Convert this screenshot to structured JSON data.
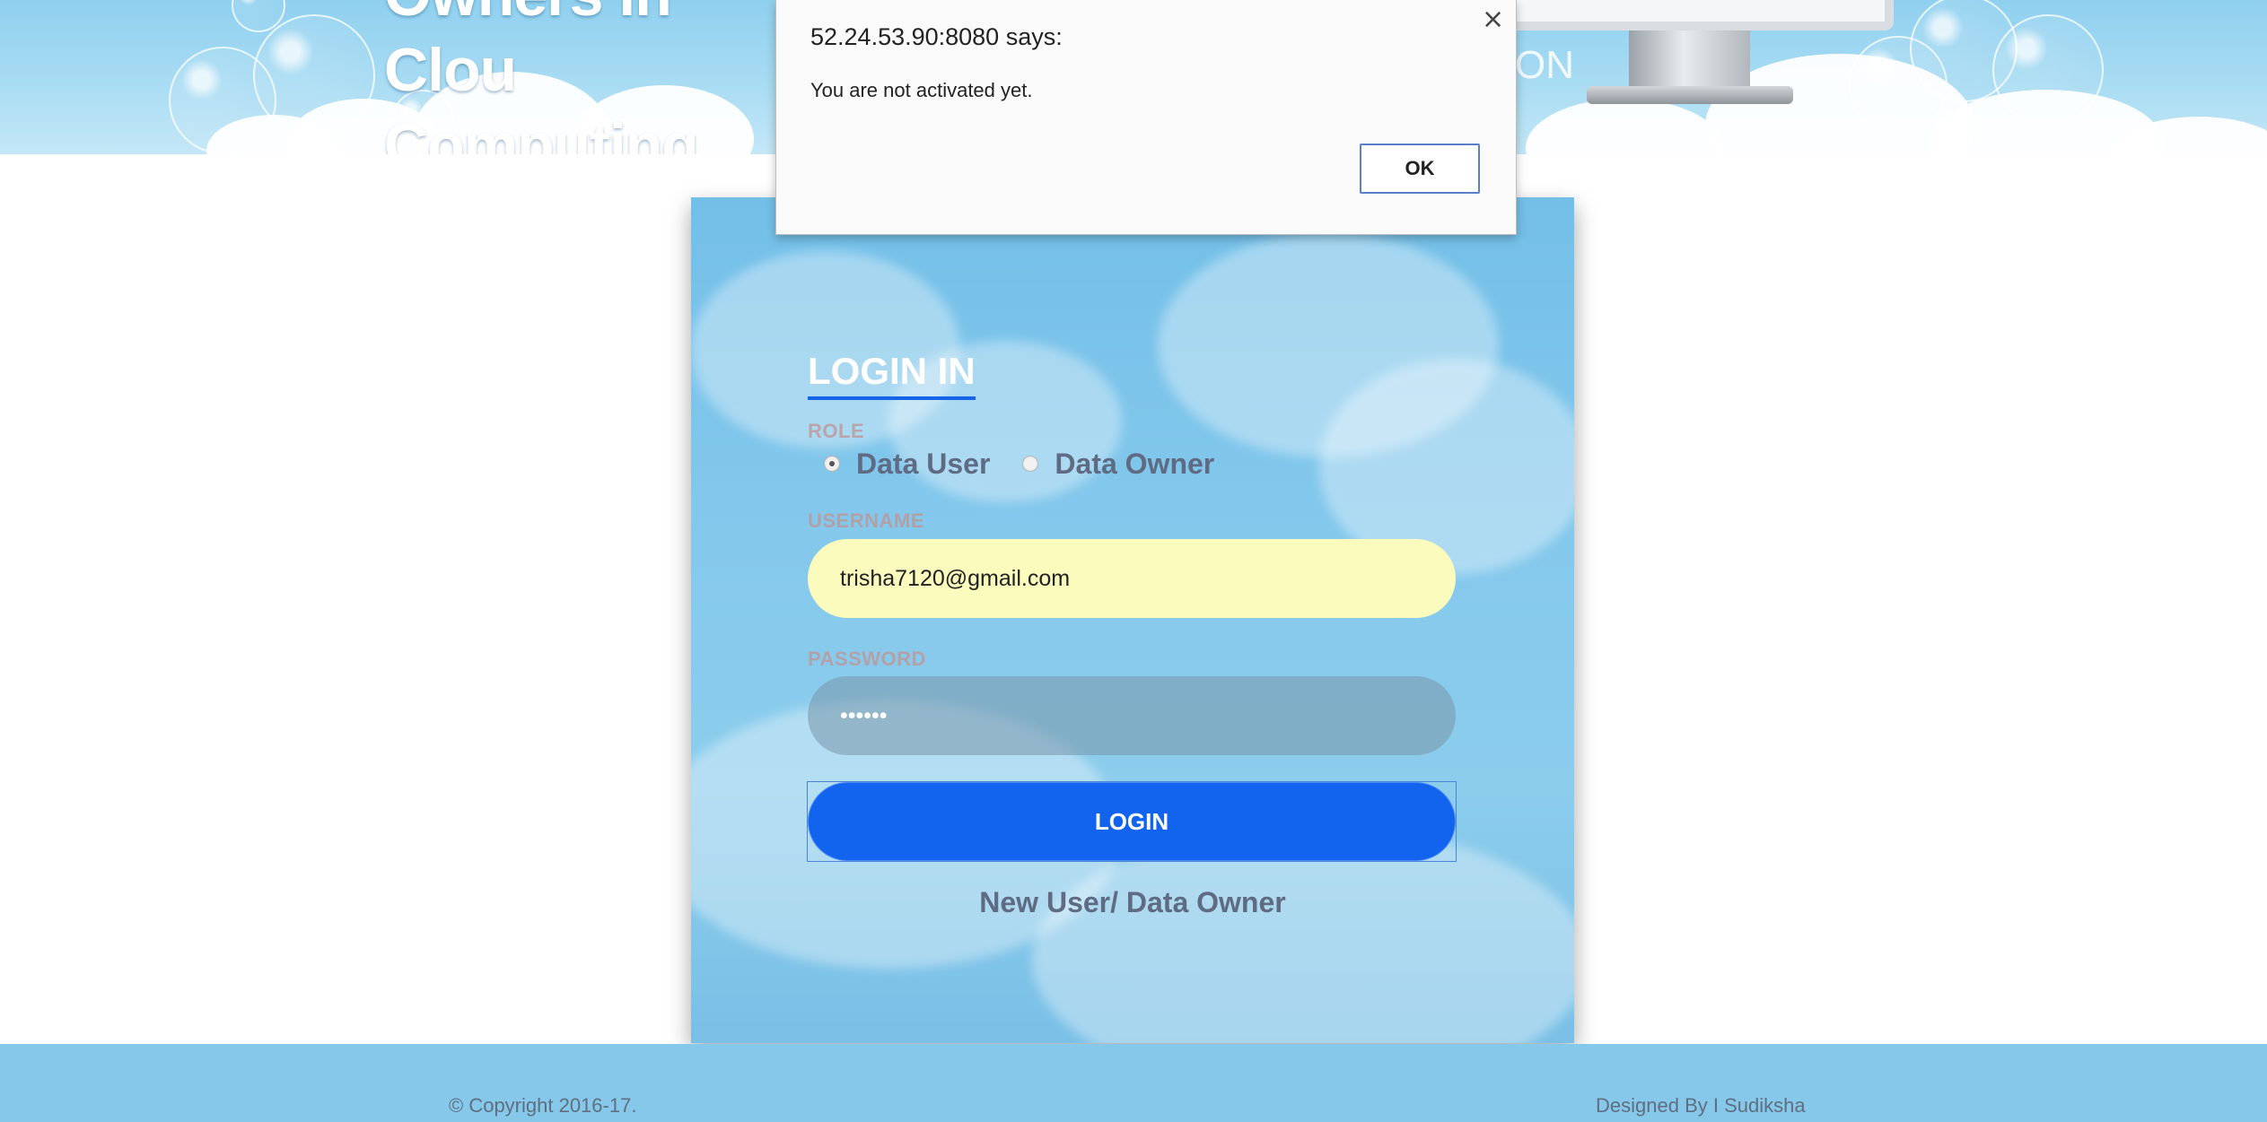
{
  "header": {
    "site_title_line1": "Owners in Clou",
    "site_title_line2": "Computing",
    "side_text": "ON"
  },
  "login": {
    "heading": "LOGIN IN",
    "role_label": "ROLE",
    "role_options": [
      {
        "label": "Data User",
        "selected": true
      },
      {
        "label": "Data Owner",
        "selected": false
      }
    ],
    "username_label": "USERNAME",
    "username_value": "trisha7120@gmail.com",
    "password_label": "PASSWORD",
    "password_value": "••••••",
    "login_button": "LOGIN",
    "new_user_link": "New User/ Data Owner"
  },
  "footer": {
    "copyright": "© Copyright 2016-17.",
    "designed_by": "Designed By I Sudiksha"
  },
  "dialog": {
    "origin": "52.24.53.90:8080 says:",
    "message": "You are not activated yet.",
    "ok_label": "OK",
    "close_glyph": "×"
  },
  "colors": {
    "header_sky": "#a9dcf3",
    "card_blue": "#84c8ec",
    "login_button": "#1263ee",
    "username_field": "#fbfbbe",
    "footer": "#86c8e9"
  }
}
